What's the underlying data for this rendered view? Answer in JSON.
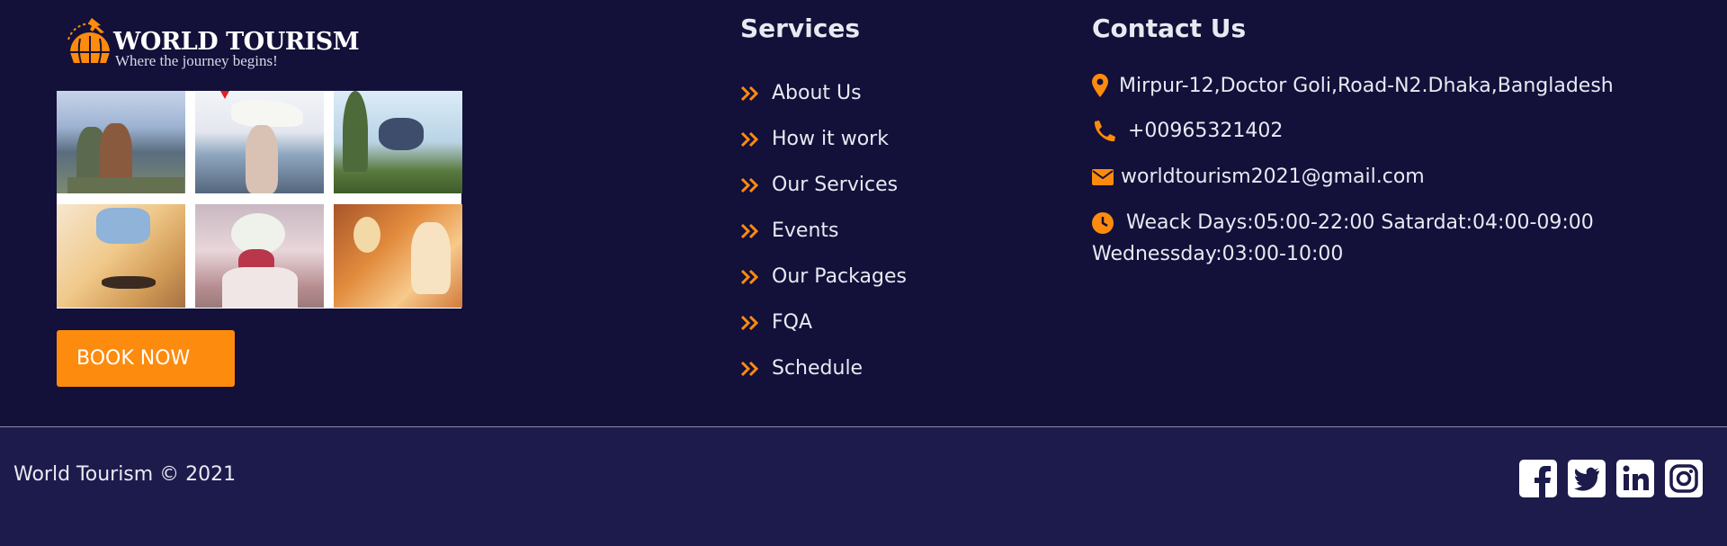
{
  "logo": {
    "title": "WORLD TOURISM",
    "tagline": "Where the journey begins!"
  },
  "gallery": {
    "photos": [
      "travel-photo-hikers",
      "travel-photo-beach-woman",
      "travel-photo-jumping-man",
      "travel-photo-skateboard",
      "travel-photo-bouquet",
      "travel-photo-mirror"
    ]
  },
  "book_now": {
    "label": "BOOK NOW"
  },
  "services": {
    "title": "Services",
    "items": [
      {
        "label": "About Us"
      },
      {
        "label": "How it work"
      },
      {
        "label": "Our Services"
      },
      {
        "label": "Events"
      },
      {
        "label": "Our Packages"
      },
      {
        "label": "FQA"
      },
      {
        "label": "Schedule"
      }
    ]
  },
  "contact": {
    "title": "Contact Us",
    "address": "Mirpur-12,Doctor Goli,Road-N2.Dhaka,Bangladesh",
    "phone": "+00965321402",
    "email": "worldtourism2021@gmail.com",
    "hours_line1": "Weack Days:05:00-22:00 Satardat:04:00-09:00",
    "hours_line2": "Wednessday:03:00-10:00"
  },
  "footer": {
    "copyright": "World Tourism © 2021",
    "social": [
      "facebook-icon",
      "twitter-icon",
      "linkedin-icon",
      "instagram-icon"
    ]
  },
  "colors": {
    "background": "#13103a",
    "bottom_bar": "#1d1b4c",
    "accent": "#fd8b0d",
    "text": "#e9e9f1"
  }
}
